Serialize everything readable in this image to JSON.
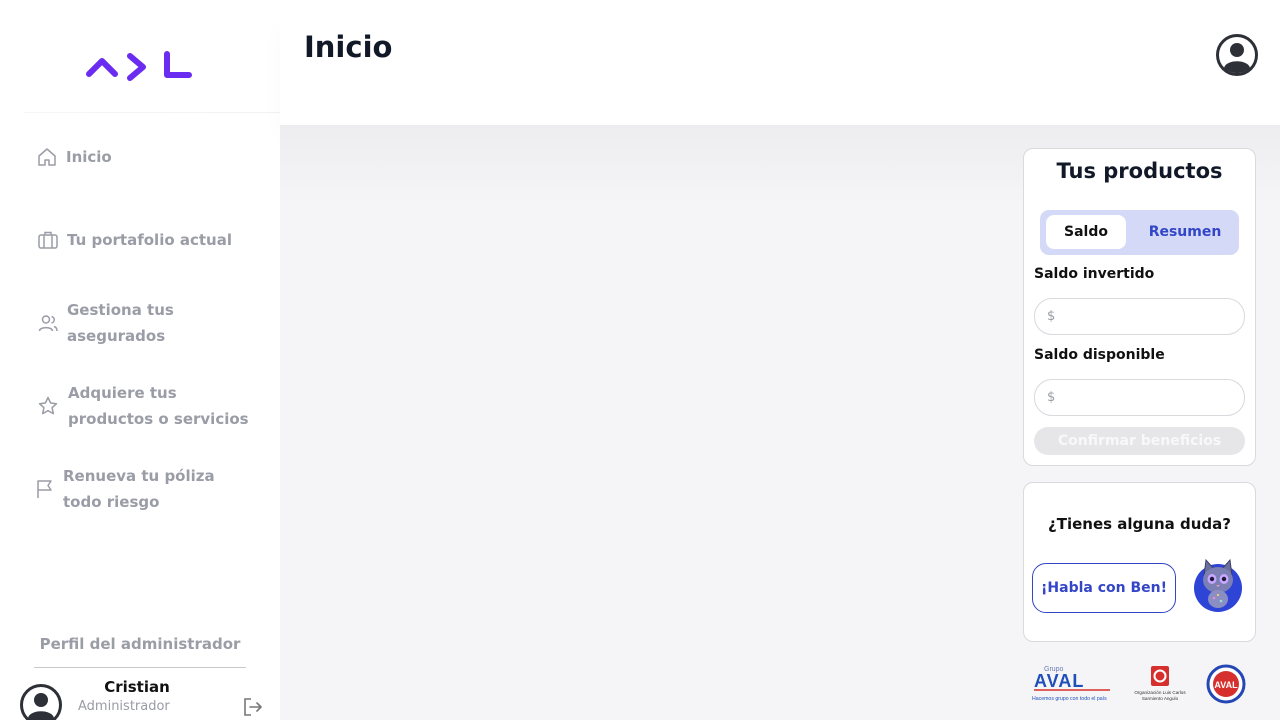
{
  "brand": {
    "logo_text": "ADL",
    "accent": "#6a2cf0"
  },
  "sidebar": {
    "items": [
      {
        "label": "Inicio",
        "icon": "home-icon"
      },
      {
        "label": "Tu portafolio actual",
        "icon": "briefcase-icon"
      },
      {
        "label": "Gestiona tus asegurados",
        "icon": "users-icon"
      },
      {
        "label": "Adquiere tus productos o servicios",
        "icon": "star-icon"
      },
      {
        "label": "Renueva tu póliza todo riesgo",
        "icon": "flag-icon"
      }
    ],
    "profile_title": "Perfil del administrador",
    "user": {
      "name": "Cristian",
      "role": "Administrador"
    }
  },
  "header": {
    "title": "Inicio"
  },
  "products": {
    "title": "Tus productos",
    "tabs": [
      "Saldo",
      "Resumen"
    ],
    "active_tab": "Saldo",
    "fields": [
      {
        "label": "Saldo invertido",
        "prefix": "$",
        "value": ""
      },
      {
        "label": "Saldo disponible",
        "prefix": "$",
        "value": ""
      }
    ],
    "confirm_label": "Confirmar beneficios"
  },
  "help": {
    "title": "¿Tienes alguna duda?",
    "button_label": "¡Habla con Ben!"
  },
  "footer_logos": {
    "grupo_aval": {
      "small": "Grupo",
      "main": "AVAL",
      "tagline": "Hacemos grupo con todo el país"
    },
    "organizacion": {
      "line1": "Organización Luis Carlos",
      "line2": "Sarmiento Angulo"
    },
    "seal": "AVAL"
  },
  "colors": {
    "primary_blue": "#3346c7",
    "toggle_bg": "#d4d9f7",
    "muted_text": "#9a9ca6"
  }
}
